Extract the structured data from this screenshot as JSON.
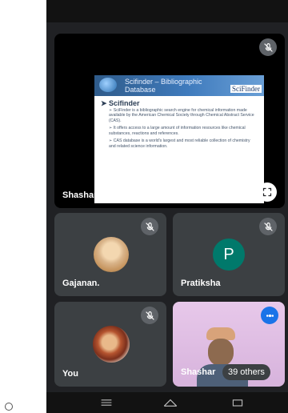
{
  "presentation": {
    "presenter_label": "Shashank is presenting",
    "slide": {
      "title": "Scifinder – Bibliographic Database",
      "logo": "SciFinder",
      "heading": "Scifinder",
      "bullets": [
        "SciFinder is a bibliographic search engine for chemical information made available by the American Chemical Society through Chemical Abstract Service (CAS).",
        "It offers access to a large amount of information resources like chemical substances, reactions and references.",
        "CAS database is a world's largest and most reliable collection of chemistry and related science information."
      ]
    }
  },
  "participants": [
    {
      "name": "Gajanan.",
      "muted": true
    },
    {
      "name": "Pratiksha",
      "initial": "P",
      "muted": true
    },
    {
      "name": "You",
      "muted": true
    },
    {
      "name": "Shashank",
      "truncated": "Shashar"
    }
  ],
  "others_count_label": "39 others",
  "icons": {
    "mute": "mic-off-icon",
    "expand": "fullscreen-icon",
    "speaking": "speaking-indicator-icon",
    "nav_menu": "menu-icon",
    "nav_home": "home-icon",
    "nav_back": "back-icon"
  },
  "colors": {
    "background": "#202124",
    "tile": "#3c4043",
    "pratiksha_avatar": "#00796b",
    "speaking_badge": "#1a73e8"
  }
}
